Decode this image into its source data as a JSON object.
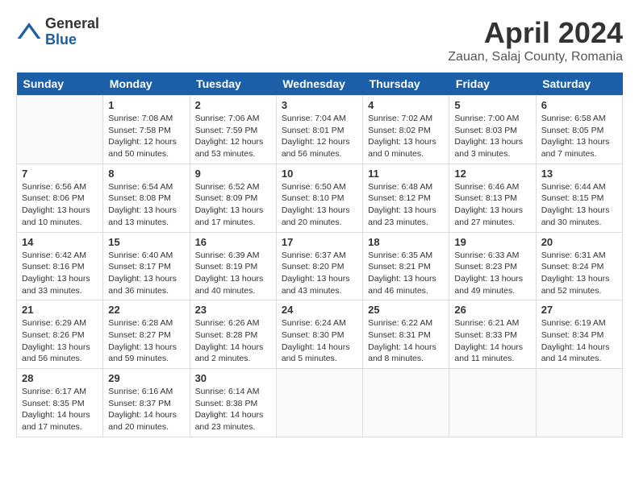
{
  "header": {
    "logo_general": "General",
    "logo_blue": "Blue",
    "month_title": "April 2024",
    "location": "Zauan, Salaj County, Romania"
  },
  "days_of_week": [
    "Sunday",
    "Monday",
    "Tuesday",
    "Wednesday",
    "Thursday",
    "Friday",
    "Saturday"
  ],
  "weeks": [
    [
      {
        "day": "",
        "sunrise": "",
        "sunset": "",
        "daylight": ""
      },
      {
        "day": "1",
        "sunrise": "Sunrise: 7:08 AM",
        "sunset": "Sunset: 7:58 PM",
        "daylight": "Daylight: 12 hours and 50 minutes."
      },
      {
        "day": "2",
        "sunrise": "Sunrise: 7:06 AM",
        "sunset": "Sunset: 7:59 PM",
        "daylight": "Daylight: 12 hours and 53 minutes."
      },
      {
        "day": "3",
        "sunrise": "Sunrise: 7:04 AM",
        "sunset": "Sunset: 8:01 PM",
        "daylight": "Daylight: 12 hours and 56 minutes."
      },
      {
        "day": "4",
        "sunrise": "Sunrise: 7:02 AM",
        "sunset": "Sunset: 8:02 PM",
        "daylight": "Daylight: 13 hours and 0 minutes."
      },
      {
        "day": "5",
        "sunrise": "Sunrise: 7:00 AM",
        "sunset": "Sunset: 8:03 PM",
        "daylight": "Daylight: 13 hours and 3 minutes."
      },
      {
        "day": "6",
        "sunrise": "Sunrise: 6:58 AM",
        "sunset": "Sunset: 8:05 PM",
        "daylight": "Daylight: 13 hours and 7 minutes."
      }
    ],
    [
      {
        "day": "7",
        "sunrise": "Sunrise: 6:56 AM",
        "sunset": "Sunset: 8:06 PM",
        "daylight": "Daylight: 13 hours and 10 minutes."
      },
      {
        "day": "8",
        "sunrise": "Sunrise: 6:54 AM",
        "sunset": "Sunset: 8:08 PM",
        "daylight": "Daylight: 13 hours and 13 minutes."
      },
      {
        "day": "9",
        "sunrise": "Sunrise: 6:52 AM",
        "sunset": "Sunset: 8:09 PM",
        "daylight": "Daylight: 13 hours and 17 minutes."
      },
      {
        "day": "10",
        "sunrise": "Sunrise: 6:50 AM",
        "sunset": "Sunset: 8:10 PM",
        "daylight": "Daylight: 13 hours and 20 minutes."
      },
      {
        "day": "11",
        "sunrise": "Sunrise: 6:48 AM",
        "sunset": "Sunset: 8:12 PM",
        "daylight": "Daylight: 13 hours and 23 minutes."
      },
      {
        "day": "12",
        "sunrise": "Sunrise: 6:46 AM",
        "sunset": "Sunset: 8:13 PM",
        "daylight": "Daylight: 13 hours and 27 minutes."
      },
      {
        "day": "13",
        "sunrise": "Sunrise: 6:44 AM",
        "sunset": "Sunset: 8:15 PM",
        "daylight": "Daylight: 13 hours and 30 minutes."
      }
    ],
    [
      {
        "day": "14",
        "sunrise": "Sunrise: 6:42 AM",
        "sunset": "Sunset: 8:16 PM",
        "daylight": "Daylight: 13 hours and 33 minutes."
      },
      {
        "day": "15",
        "sunrise": "Sunrise: 6:40 AM",
        "sunset": "Sunset: 8:17 PM",
        "daylight": "Daylight: 13 hours and 36 minutes."
      },
      {
        "day": "16",
        "sunrise": "Sunrise: 6:39 AM",
        "sunset": "Sunset: 8:19 PM",
        "daylight": "Daylight: 13 hours and 40 minutes."
      },
      {
        "day": "17",
        "sunrise": "Sunrise: 6:37 AM",
        "sunset": "Sunset: 8:20 PM",
        "daylight": "Daylight: 13 hours and 43 minutes."
      },
      {
        "day": "18",
        "sunrise": "Sunrise: 6:35 AM",
        "sunset": "Sunset: 8:21 PM",
        "daylight": "Daylight: 13 hours and 46 minutes."
      },
      {
        "day": "19",
        "sunrise": "Sunrise: 6:33 AM",
        "sunset": "Sunset: 8:23 PM",
        "daylight": "Daylight: 13 hours and 49 minutes."
      },
      {
        "day": "20",
        "sunrise": "Sunrise: 6:31 AM",
        "sunset": "Sunset: 8:24 PM",
        "daylight": "Daylight: 13 hours and 52 minutes."
      }
    ],
    [
      {
        "day": "21",
        "sunrise": "Sunrise: 6:29 AM",
        "sunset": "Sunset: 8:26 PM",
        "daylight": "Daylight: 13 hours and 56 minutes."
      },
      {
        "day": "22",
        "sunrise": "Sunrise: 6:28 AM",
        "sunset": "Sunset: 8:27 PM",
        "daylight": "Daylight: 13 hours and 59 minutes."
      },
      {
        "day": "23",
        "sunrise": "Sunrise: 6:26 AM",
        "sunset": "Sunset: 8:28 PM",
        "daylight": "Daylight: 14 hours and 2 minutes."
      },
      {
        "day": "24",
        "sunrise": "Sunrise: 6:24 AM",
        "sunset": "Sunset: 8:30 PM",
        "daylight": "Daylight: 14 hours and 5 minutes."
      },
      {
        "day": "25",
        "sunrise": "Sunrise: 6:22 AM",
        "sunset": "Sunset: 8:31 PM",
        "daylight": "Daylight: 14 hours and 8 minutes."
      },
      {
        "day": "26",
        "sunrise": "Sunrise: 6:21 AM",
        "sunset": "Sunset: 8:33 PM",
        "daylight": "Daylight: 14 hours and 11 minutes."
      },
      {
        "day": "27",
        "sunrise": "Sunrise: 6:19 AM",
        "sunset": "Sunset: 8:34 PM",
        "daylight": "Daylight: 14 hours and 14 minutes."
      }
    ],
    [
      {
        "day": "28",
        "sunrise": "Sunrise: 6:17 AM",
        "sunset": "Sunset: 8:35 PM",
        "daylight": "Daylight: 14 hours and 17 minutes."
      },
      {
        "day": "29",
        "sunrise": "Sunrise: 6:16 AM",
        "sunset": "Sunset: 8:37 PM",
        "daylight": "Daylight: 14 hours and 20 minutes."
      },
      {
        "day": "30",
        "sunrise": "Sunrise: 6:14 AM",
        "sunset": "Sunset: 8:38 PM",
        "daylight": "Daylight: 14 hours and 23 minutes."
      },
      {
        "day": "",
        "sunrise": "",
        "sunset": "",
        "daylight": ""
      },
      {
        "day": "",
        "sunrise": "",
        "sunset": "",
        "daylight": ""
      },
      {
        "day": "",
        "sunrise": "",
        "sunset": "",
        "daylight": ""
      },
      {
        "day": "",
        "sunrise": "",
        "sunset": "",
        "daylight": ""
      }
    ]
  ]
}
